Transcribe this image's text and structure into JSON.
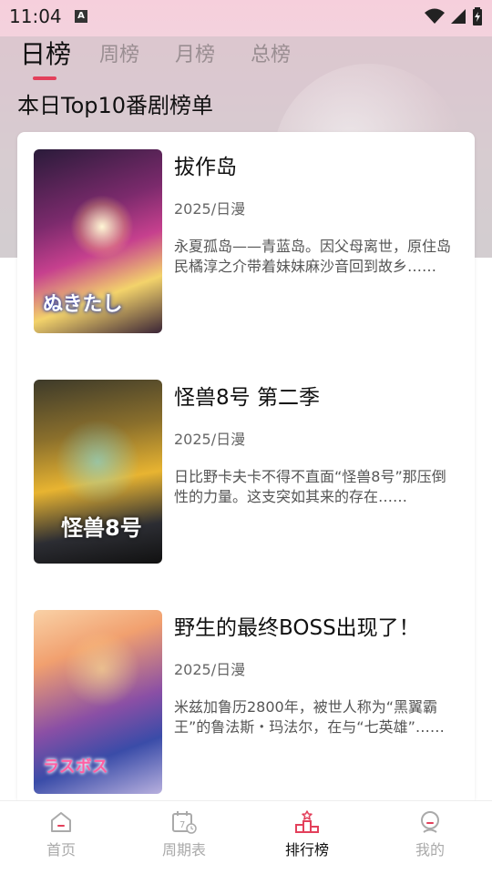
{
  "status_bar": {
    "time": "11:04",
    "notification_letter": "A"
  },
  "tabs": [
    {
      "label": "日榜",
      "active": true
    },
    {
      "label": "周榜",
      "active": false
    },
    {
      "label": "月榜",
      "active": false
    },
    {
      "label": "总榜",
      "active": false
    }
  ],
  "section_title": "本日Top10番剧榜单",
  "items": [
    {
      "title": "拔作岛",
      "meta": "2025/日漫",
      "description": "永夏孤岛——青蓝岛。因父母离世，原住岛民橘淳之介带着妹妹麻沙音回到故乡……",
      "poster_text": "ぬきたし"
    },
    {
      "title": "怪兽8号 第二季",
      "meta": "2025/日漫",
      "description": "日比野卡夫卡不得不直面“怪兽8号”那压倒性的力量。这支突如其来的存在……",
      "poster_text": "怪兽8号"
    },
    {
      "title": "野生的最终BOSS出现了！",
      "meta": "2025/日漫",
      "description": "米兹加鲁历2800年，被世人称为“黑翼霸王”的鲁法斯・玛法尔，在与“七英雄”……",
      "poster_text": "ラスボス"
    }
  ],
  "bottom_nav": [
    {
      "label": "首页",
      "icon": "home-icon",
      "active": false
    },
    {
      "label": "周期表",
      "icon": "calendar-icon",
      "active": false
    },
    {
      "label": "排行榜",
      "icon": "podium-icon",
      "active": true
    },
    {
      "label": "我的",
      "icon": "profile-icon",
      "active": false
    }
  ],
  "colors": {
    "accent": "#e3405b",
    "inactive": "#aaaaaa",
    "header_pink": "#f6cfdc"
  }
}
